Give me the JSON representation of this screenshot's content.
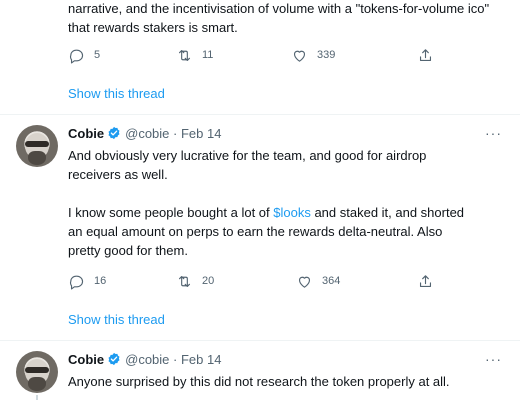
{
  "tweet1": {
    "text_line1": "narrative, and the incentivisation of volume with a  \"tokens-for-volume ico\"",
    "text_line2": "that rewards stakers is smart.",
    "replies": "5",
    "retweets": "11",
    "likes": "339",
    "show_thread": "Show this thread"
  },
  "tweet2": {
    "name": "Cobie",
    "handle": "@cobie · Feb 14",
    "more": "···",
    "p1_line1": "And obviously very lucrative for the team, and good for airdrop",
    "p1_line2": "receivers as well.",
    "p2_before_link": "I know some people bought a lot of ",
    "p2_link": "$looks",
    "p2_after_link": " and staked it, and shorted",
    "p2_line2": "an equal amount on perps to earn the rewards delta-neutral. Also",
    "p2_line3": "pretty good for them.",
    "replies": "16",
    "retweets": "20",
    "likes": "364",
    "show_thread": "Show this thread"
  },
  "tweet3": {
    "name": "Cobie",
    "handle": "@cobie · Feb 14",
    "more": "···",
    "text": "Anyone surprised by this did not research the token properly at all."
  },
  "icons": {
    "reply": "reply-icon",
    "retweet": "retweet-icon",
    "like": "heart-icon",
    "share": "share-icon",
    "verified": "verified-badge-icon"
  },
  "colors": {
    "link": "#1d9bf0",
    "secondary_text": "#536471",
    "verified": "#1d9bf0"
  }
}
